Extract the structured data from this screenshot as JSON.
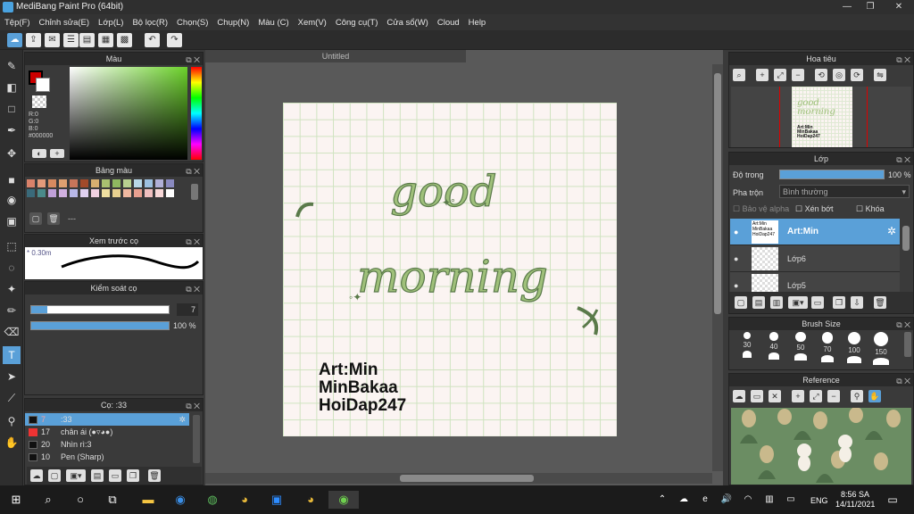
{
  "window": {
    "title": "MediBang Paint Pro (64bit)",
    "min": "—",
    "max": "❐",
    "close": "✕"
  },
  "menu": [
    "Tệp(F)",
    "Chỉnh sửa(E)",
    "Lớp(L)",
    "Bộ lọc(R)",
    "Chọn(S)",
    "Chụp(N)",
    "Màu (C)",
    "Xem(V)",
    "Công cụ(T)",
    "Cửa sổ(W)",
    "Cloud",
    "Help"
  ],
  "panels": {
    "color": {
      "title": "Màu",
      "r": "R:0",
      "g": "G:0",
      "b": "B:0",
      "hex": "#000000"
    },
    "palette": {
      "title": "Bảng màu",
      "name": "---"
    },
    "brush_preview": {
      "title": "Xem trước cọ",
      "size": "0.30m"
    },
    "brush_control": {
      "title": "Kiểm soát cọ",
      "size": "7",
      "opacity": "100 %"
    },
    "brush": {
      "title": "Cọ: :33",
      "items": [
        {
          "num": "7",
          "name": ":33",
          "active": true
        },
        {
          "num": "17",
          "name": "chân ái (●▿◕●)",
          "active": false
        },
        {
          "num": "20",
          "name": "Nhìn rì:3",
          "active": false
        },
        {
          "num": "10",
          "name": "Pen (Sharp)",
          "active": false
        }
      ]
    },
    "navigator": {
      "title": "Hoa tiêu"
    },
    "layers": {
      "title": "Lớp",
      "opacity_label": "Độ trong",
      "opacity_value": "100 %",
      "blend_label": "Pha trộn",
      "blend_value": "Bình thường",
      "protect_alpha": "Bảo vệ alpha",
      "clipping": "Xén bớt",
      "lock": "Khóa",
      "items": [
        {
          "name": "Art:Min",
          "thumb": "Art:Min MinBakaa HoiDap247",
          "active": true
        },
        {
          "name": "Lớp6",
          "active": false
        },
        {
          "name": "Lớp5",
          "active": false
        }
      ]
    },
    "brush_size": {
      "title": "Brush Size",
      "sizes": [
        "30",
        "40",
        "50",
        "70",
        "100",
        "150"
      ]
    },
    "reference": {
      "title": "Reference"
    }
  },
  "document": {
    "tab": "Untitled",
    "artwork_line1": "good",
    "artwork_line2": "morning",
    "signature": [
      "Art:Min",
      "MinBakaa",
      "HoiDap247"
    ]
  },
  "taskbar": {
    "lang": "ENG",
    "time": "8:56 SA",
    "date": "14/11/2021"
  },
  "colors": {
    "accent": "#5aa0d8",
    "lettering": "#9fc07a",
    "lettering_dark": "#5a7a4a"
  }
}
